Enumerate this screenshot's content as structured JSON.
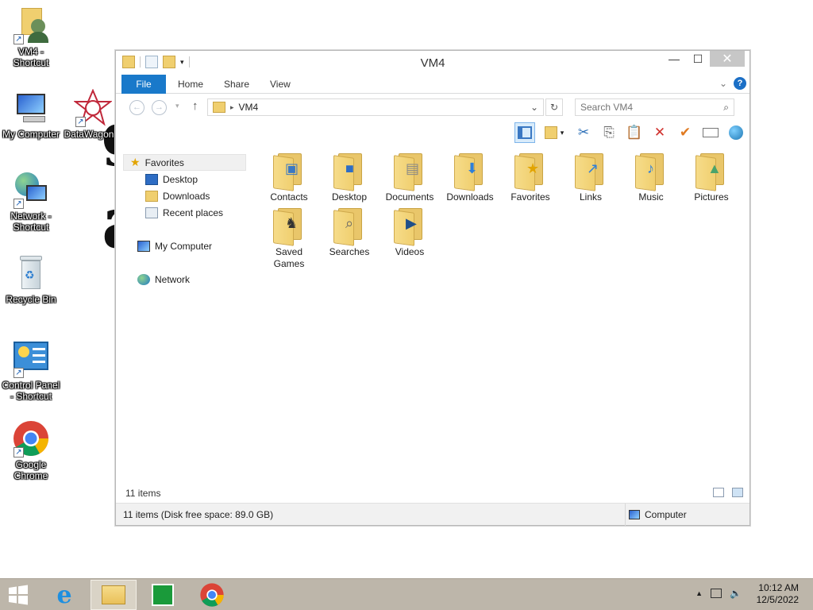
{
  "desktop": {
    "icons": [
      {
        "label": "VM4 - Shortcut",
        "icon": "user-folder-icon"
      },
      {
        "label": "My Computer",
        "icon": "computer-icon"
      },
      {
        "label": "DataWagon...",
        "icon": "datawagon-icon"
      },
      {
        "label": "Network - Shortcut",
        "icon": "network-icon"
      },
      {
        "label": "Recycle Bin",
        "icon": "recycle-bin-icon"
      },
      {
        "label": "Control Panel - Shortcut",
        "icon": "control-panel-icon"
      },
      {
        "label": "Google Chrome",
        "icon": "chrome-icon"
      }
    ]
  },
  "window": {
    "title": "VM4",
    "controls": {
      "minimize": "—",
      "maximize": "☐",
      "close": "✕"
    }
  },
  "ribbon": {
    "tabs": [
      "File",
      "Home",
      "Share",
      "View"
    ],
    "help": "?"
  },
  "address_bar": {
    "path": "VM4",
    "search_placeholder": "Search VM4"
  },
  "nav_pane": {
    "favorites": "Favorites",
    "favorite_items": [
      "Desktop",
      "Downloads",
      "Recent places"
    ],
    "my_computer": "My Computer",
    "network": "Network"
  },
  "content": {
    "items": [
      {
        "label": "Contacts",
        "icon": "contacts-folder-icon"
      },
      {
        "label": "Desktop",
        "icon": "desktop-folder-icon"
      },
      {
        "label": "Documents",
        "icon": "documents-folder-icon"
      },
      {
        "label": "Downloads",
        "icon": "downloads-folder-icon"
      },
      {
        "label": "Favorites",
        "icon": "favorites-folder-icon"
      },
      {
        "label": "Links",
        "icon": "links-folder-icon"
      },
      {
        "label": "Music",
        "icon": "music-folder-icon"
      },
      {
        "label": "Pictures",
        "icon": "pictures-folder-icon"
      },
      {
        "label": "Saved Games",
        "icon": "saved-games-folder-icon"
      },
      {
        "label": "Searches",
        "icon": "searches-folder-icon"
      },
      {
        "label": "Videos",
        "icon": "videos-folder-icon"
      }
    ],
    "item_count": "11 items"
  },
  "status_bar": {
    "left": "11 items (Disk free space: 89.0 GB)",
    "right": "Computer"
  },
  "taskbar": {
    "apps": [
      "start-icon",
      "internet-explorer-icon",
      "file-explorer-icon",
      "store-icon",
      "chrome-icon"
    ],
    "clock_time": "10:12 AM",
    "clock_date": "12/5/2022"
  }
}
